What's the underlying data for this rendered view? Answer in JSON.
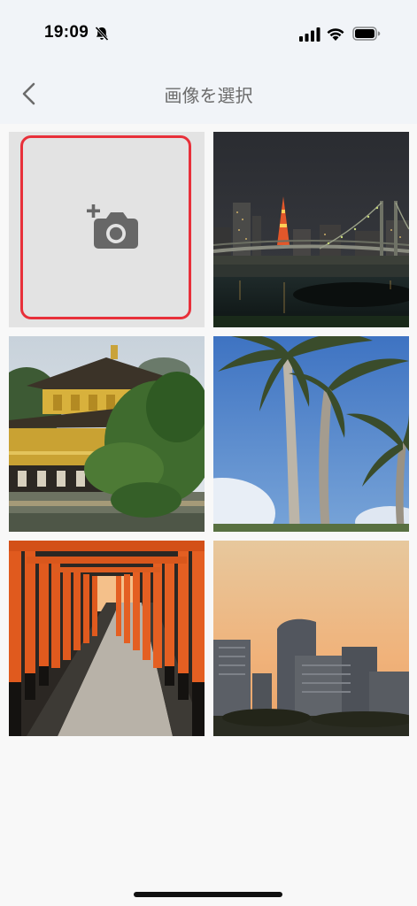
{
  "status_bar": {
    "time": "19:09",
    "icons": [
      "bell-off-icon",
      "signal-icon",
      "wifi-icon",
      "battery-icon"
    ]
  },
  "nav": {
    "title": "画像を選択",
    "back_icon": "chevron-left-icon"
  },
  "grid": {
    "add_tile_icon": "camera-plus-icon",
    "accent_color": "#e8303a",
    "photos": [
      {
        "name": "photo-tokyo-night-bridge"
      },
      {
        "name": "photo-golden-pavilion"
      },
      {
        "name": "photo-palm-trees"
      },
      {
        "name": "photo-torii-path"
      },
      {
        "name": "photo-city-sunset"
      }
    ]
  }
}
